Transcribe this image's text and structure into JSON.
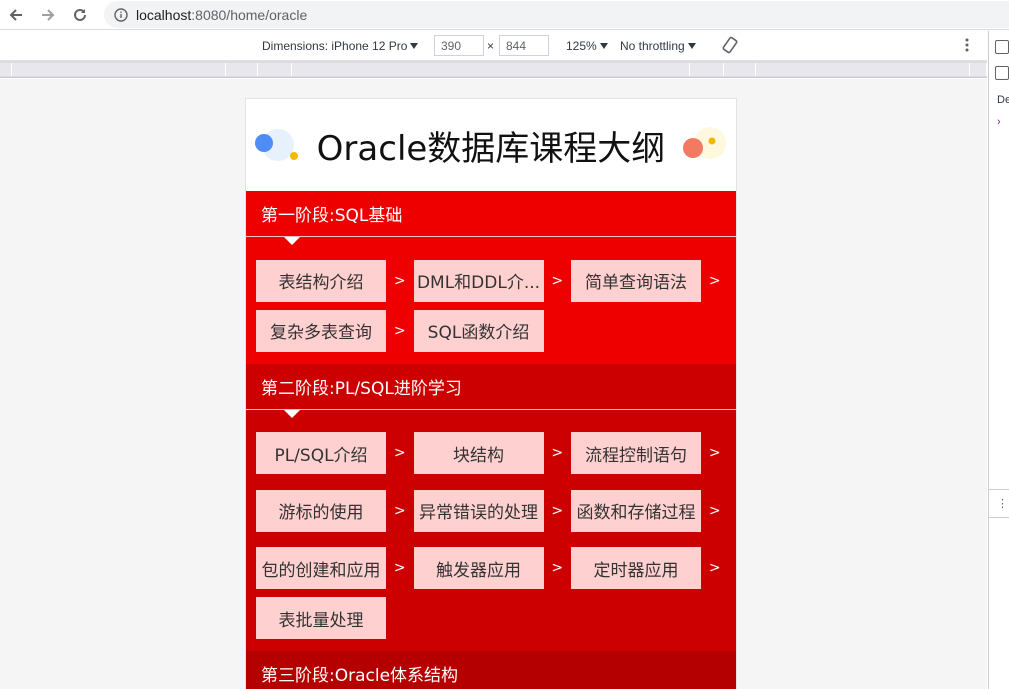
{
  "browser": {
    "url_host": "localhost",
    "url_path": ":8080/home/oracle"
  },
  "device_toolbar": {
    "dimensions_label": "Dimensions: iPhone 12 Pro",
    "width_value": "390",
    "times_sign": "×",
    "height_value": "844",
    "zoom": "125%",
    "throttling": "No throttling"
  },
  "devtools": {
    "partial_label": "De"
  },
  "page": {
    "title": "Oracle数据库课程大纲",
    "stages": [
      {
        "title": "第一阶段:SQL基础",
        "color": "#ee0000",
        "rows": [
          [
            "表结构介绍",
            "DML和DDL介...",
            "简单查询语法"
          ],
          [
            "复杂多表查询",
            "SQL函数介绍"
          ]
        ]
      },
      {
        "title": "第二阶段:PL/SQL进阶学习",
        "color": "#cc0000",
        "rows": [
          [
            "PL/SQL介绍",
            "块结构",
            "流程控制语句"
          ],
          [
            "游标的使用",
            "异常错误的处理",
            "函数和存储过程"
          ],
          [
            "包的创建和应用",
            "触发器应用",
            "定时器应用"
          ],
          [
            "表批量处理"
          ]
        ]
      },
      {
        "title": "第三阶段:Oracle体系结构",
        "color": "#b50000",
        "rows": []
      }
    ],
    "arrow_char": ">"
  }
}
